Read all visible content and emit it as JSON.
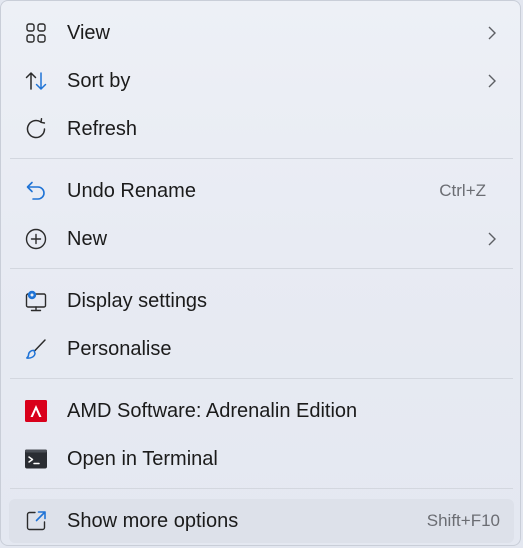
{
  "menu": {
    "items": [
      {
        "label": "View",
        "icon": "grid-icon",
        "has_submenu": true
      },
      {
        "label": "Sort by",
        "icon": "sort-arrows-icon",
        "has_submenu": true
      },
      {
        "label": "Refresh",
        "icon": "refresh-icon",
        "has_submenu": false
      },
      {
        "label": "Undo Rename",
        "icon": "undo-icon",
        "shortcut": "Ctrl+Z"
      },
      {
        "label": "New",
        "icon": "plus-circle-icon",
        "has_submenu": true
      },
      {
        "label": "Display settings",
        "icon": "display-settings-icon"
      },
      {
        "label": "Personalise",
        "icon": "brush-icon"
      },
      {
        "label": "AMD Software: Adrenalin Edition",
        "icon": "amd-logo-icon"
      },
      {
        "label": "Open in Terminal",
        "icon": "terminal-icon"
      },
      {
        "label": "Show more options",
        "icon": "show-more-icon",
        "shortcut": "Shift+F10"
      }
    ]
  },
  "colors": {
    "accent_blue": "#1f73d6",
    "amd_red": "#d9001b",
    "hover_bg": "#dde1ea"
  }
}
